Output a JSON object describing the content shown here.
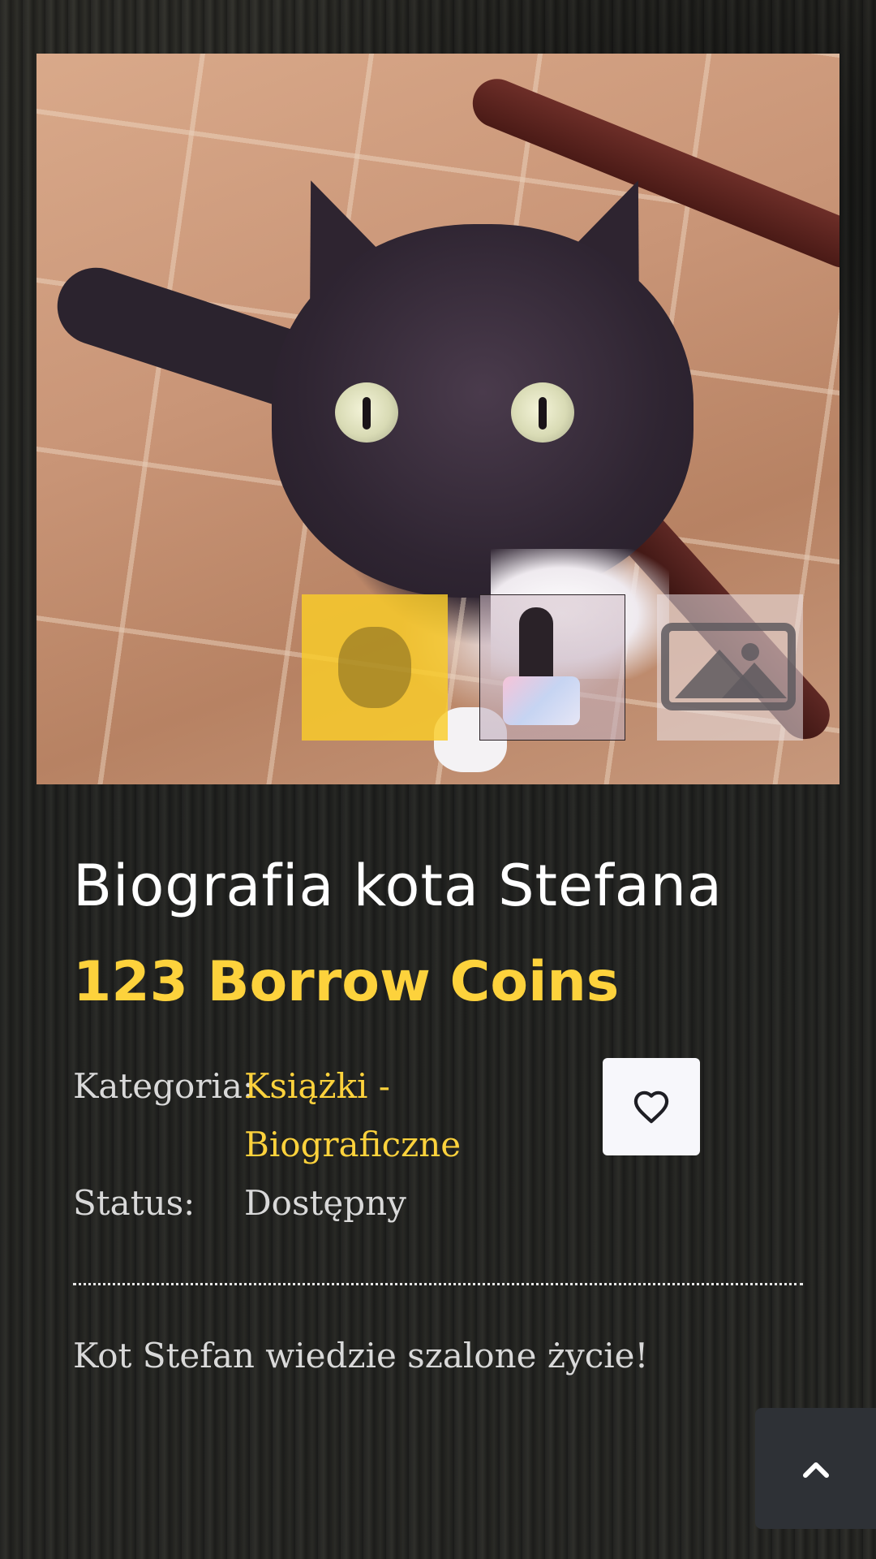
{
  "product": {
    "title": "Biografia kota Stefana",
    "price": "123 Borrow Coins",
    "category_label": "Kategoria:",
    "category_value_line1": "Książki -",
    "category_value_line2": "Biograficzne",
    "status_label": "Status:",
    "status_value": "Dostępny",
    "description": "Kot Stefan wiedzie szalone życie!"
  },
  "gallery": {
    "thumbnails": [
      {
        "name": "cat-photo-thumbnail",
        "state": "selected"
      },
      {
        "name": "cat-figure-thumbnail",
        "state": "default"
      },
      {
        "name": "placeholder-image-thumbnail",
        "state": "default"
      }
    ]
  },
  "icons": {
    "favorite": "heart-icon",
    "scroll_top": "chevron-up-icon",
    "placeholder": "image-placeholder-icon"
  },
  "colors": {
    "accent": "#fdd23c",
    "text": "#ffffff",
    "muted_text": "#d9d9d9",
    "favorite_button_bg": "#f7f7fb",
    "scroll_top_bg": "#2e3136"
  }
}
